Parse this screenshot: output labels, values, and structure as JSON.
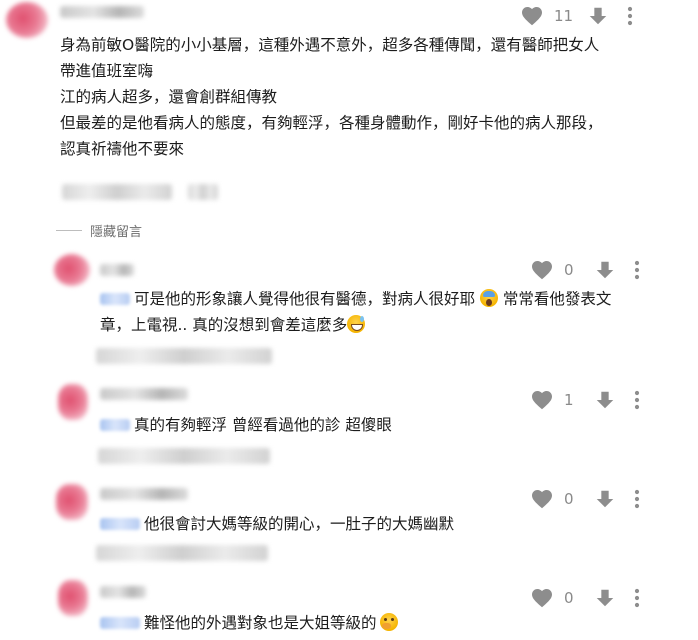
{
  "top_comment": {
    "lines": [
      "身為前敏O醫院的小小基層，這種外遇不意外，超多各種傳聞，還有醫師把女人",
      "帶進值班室嗨",
      "江的病人超多，還會創群組傳教",
      "但最差的是他看病人的態度，有夠輕浮，各種身體動作，剛好卡他的病人那段，",
      "認真祈禱他不要來"
    ],
    "likes": "11"
  },
  "hidden_replies_label": "隱藏留言",
  "replies": [
    {
      "lines": [
        "可是他的形象讓人覺得他很有醫德，對病人很好耶 ",
        " 常常看他發表文",
        "章，上電視.. 真的沒想到會差這麼多"
      ],
      "likes": "0",
      "emojis": [
        "face-screaming-icon",
        "grinning-sweat-icon"
      ]
    },
    {
      "lines": [
        "真的有夠輕浮 曾經看過他的診 超傻眼"
      ],
      "likes": "1"
    },
    {
      "lines": [
        "他很會討大媽等級的開心，一肚子的大媽幽默"
      ],
      "likes": "0"
    },
    {
      "lines": [
        "難怪他的外遇對象也是大姐等級的"
      ],
      "likes": "0",
      "emojis": [
        "thinking-face-icon"
      ]
    }
  ],
  "colors": {
    "icon_gray": "#8d8d8d",
    "text": "#1c1c1c",
    "tag_blue": "#a9c4f0"
  }
}
